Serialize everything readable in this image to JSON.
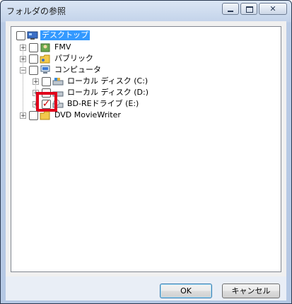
{
  "window": {
    "title": "フォルダの参照"
  },
  "tree": {
    "items": [
      {
        "label": "デスクトップ",
        "icon": "desktop-icon",
        "checked": false,
        "selected": true
      },
      {
        "label": "FMV",
        "icon": "user-folder-icon",
        "checked": false
      },
      {
        "label": "パブリック",
        "icon": "public-folder-icon",
        "checked": false
      },
      {
        "label": "コンピュータ",
        "icon": "computer-icon",
        "checked": false
      },
      {
        "label": "ローカル ディスク (C:)",
        "icon": "local-disk-icon",
        "checked": false
      },
      {
        "label": "ローカル ディスク (D:)",
        "icon": "local-disk-icon",
        "checked": false
      },
      {
        "label": "BD-REドライブ (E:)",
        "icon": "bd-drive-icon",
        "checked": true
      },
      {
        "label": "DVD MovieWriter",
        "icon": "folder-icon",
        "checked": false
      }
    ]
  },
  "buttons": {
    "ok": "OK",
    "cancel": "キャンセル"
  },
  "colors": {
    "highlight": "#e0001b",
    "selection": "#3399ff"
  }
}
